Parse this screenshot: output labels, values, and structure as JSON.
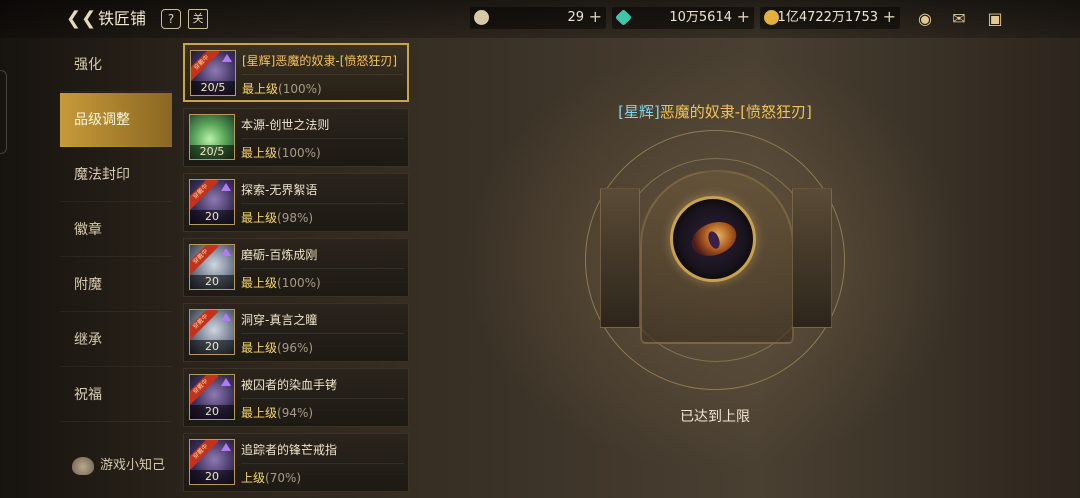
{
  "header": {
    "title": "铁匠铺",
    "back_icon": "back-arrow-icon",
    "help_label": "?",
    "calendar_label": "关"
  },
  "currency": [
    {
      "name": "cera-coin",
      "value": "29",
      "color": "#d8c9a6"
    },
    {
      "name": "crystal",
      "value": "10万5614",
      "color": "#3fc6a8"
    },
    {
      "name": "gold",
      "value": "1亿4722万1753",
      "color": "#e3b03d"
    }
  ],
  "top_icons": [
    "bag-icon",
    "mail-icon",
    "chat-icon"
  ],
  "nav": {
    "items": [
      {
        "label": "强化",
        "active": false
      },
      {
        "label": "品级调整",
        "active": true
      },
      {
        "label": "魔法封印",
        "active": false
      },
      {
        "label": "徽章",
        "active": false
      },
      {
        "label": "附魔",
        "active": false
      },
      {
        "label": "继承",
        "active": false
      },
      {
        "label": "祝福",
        "active": false
      }
    ],
    "tips_label": "游戏小知己"
  },
  "items": [
    {
      "name": "[星辉]恶魔的奴隶-[愤怒狂刃]",
      "level": "20/5",
      "grade": "最上级",
      "percent": "(100%)",
      "selected": true,
      "gold": true,
      "thumb": "purple",
      "ribbon": "穿戴中"
    },
    {
      "name": "本源-创世之法则",
      "level": "20/5",
      "grade": "最上级",
      "percent": "(100%)",
      "selected": false,
      "gold": false,
      "thumb": "green",
      "ribbon": ""
    },
    {
      "name": "探索-无界絮语",
      "level": "20",
      "grade": "最上级",
      "percent": "(98%)",
      "selected": false,
      "gold": false,
      "thumb": "purple",
      "ribbon": "穿戴中"
    },
    {
      "name": "磨砺-百炼成刚",
      "level": "20",
      "grade": "最上级",
      "percent": "(100%)",
      "selected": false,
      "gold": false,
      "thumb": "grey",
      "ribbon": "穿戴中"
    },
    {
      "name": "洞穿-真言之瞳",
      "level": "20",
      "grade": "最上级",
      "percent": "(96%)",
      "selected": false,
      "gold": false,
      "thumb": "grey",
      "ribbon": "穿戴中"
    },
    {
      "name": "被囚者的染血手铐",
      "level": "20",
      "grade": "最上级",
      "percent": "(94%)",
      "selected": false,
      "gold": false,
      "thumb": "purple",
      "ribbon": "穿戴中"
    },
    {
      "name": "追踪者的锋芒戒指",
      "level": "20",
      "grade": "上级",
      "percent": "(70%)",
      "selected": false,
      "gold": false,
      "thumb": "purple",
      "ribbon": "穿戴中"
    }
  ],
  "detail": {
    "bracket": "[星辉]",
    "name": "恶魔的奴隶-[愤怒狂刃]",
    "status": "已达到上限"
  }
}
